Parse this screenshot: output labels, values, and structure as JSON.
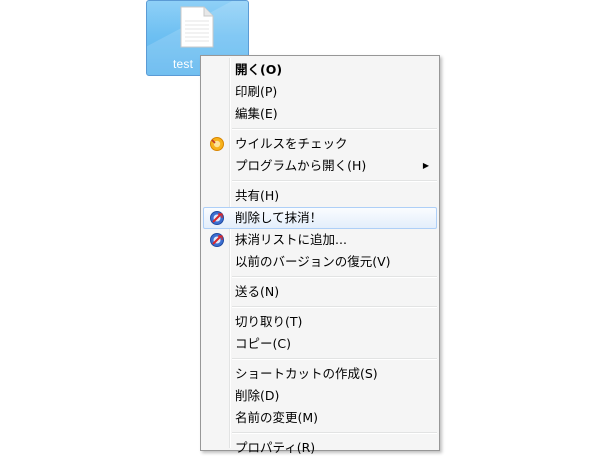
{
  "desktop": {
    "file_name": "test"
  },
  "menu": {
    "groups": [
      [
        {
          "label": "開く(O)",
          "bold": true
        },
        {
          "label": "印刷(P)"
        },
        {
          "label": "編集(E)"
        }
      ],
      [
        {
          "label": "ウイルスをチェック",
          "icon": "antivirus-icon"
        },
        {
          "label": "プログラムから開く(H)",
          "submenu": true
        }
      ],
      [
        {
          "label": "共有(H)"
        },
        {
          "label": "削除して抹消！",
          "icon": "shredder-icon",
          "hovered": true
        },
        {
          "label": "抹消リストに追加...",
          "icon": "shredder-icon"
        },
        {
          "label": "以前のバージョンの復元(V)"
        }
      ],
      [
        {
          "label": "送る(N)"
        }
      ],
      [
        {
          "label": "切り取り(T)"
        },
        {
          "label": "コピー(C)"
        }
      ],
      [
        {
          "label": "ショートカットの作成(S)"
        },
        {
          "label": "削除(D)"
        },
        {
          "label": "名前の変更(M)"
        }
      ],
      [
        {
          "label": "プロパティ(R)"
        }
      ]
    ],
    "submenu_arrow": "▶"
  },
  "colors": {
    "selection": "#6ec0f2",
    "menu_bg": "#f5f5f5",
    "hover_border": "#aecff7"
  }
}
